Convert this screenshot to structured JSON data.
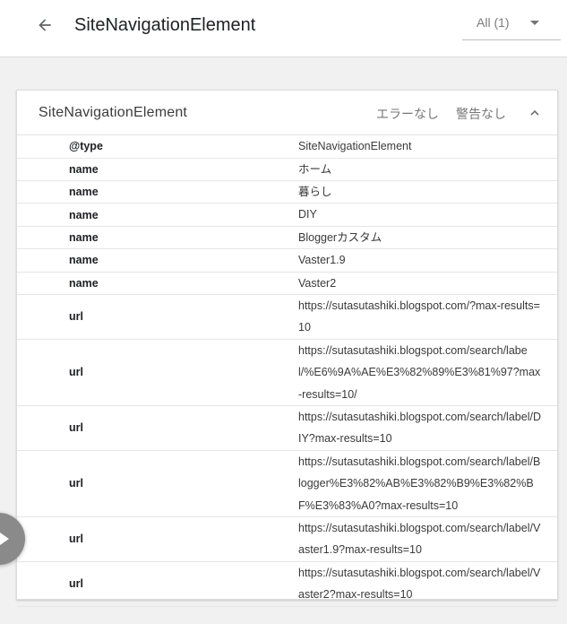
{
  "header": {
    "title": "SiteNavigationElement",
    "filter_label": "All (1)",
    "back_icon": "arrow-back-icon",
    "dropdown_icon": "caret-down-icon"
  },
  "card": {
    "title": "SiteNavigationElement",
    "errors": "エラーなし",
    "warnings": "警告なし",
    "collapse_icon": "chevron-up-icon"
  },
  "rows": [
    {
      "key": "@type",
      "value": "SiteNavigationElement"
    },
    {
      "key": "name",
      "value": "ホーム"
    },
    {
      "key": "name",
      "value": "暮らし"
    },
    {
      "key": "name",
      "value": "DIY"
    },
    {
      "key": "name",
      "value": "Bloggerカスタム"
    },
    {
      "key": "name",
      "value": "Vaster1.9"
    },
    {
      "key": "name",
      "value": "Vaster2"
    },
    {
      "key": "url",
      "value": "https://sutasutashiki.blogspot.com/?max-results=10"
    },
    {
      "key": "url",
      "value": "https://sutasutashiki.blogspot.com/search/label/%E6%9A%AE%E3%82%89%E3%81%97?max-results=10/"
    },
    {
      "key": "url",
      "value": "https://sutasutashiki.blogspot.com/search/label/DIY?max-results=10"
    },
    {
      "key": "url",
      "value": "https://sutasutashiki.blogspot.com/search/label/Blogger%E3%82%AB%E3%82%B9%E3%82%BF%E3%83%A0?max-results=10"
    },
    {
      "key": "url",
      "value": "https://sutasutashiki.blogspot.com/search/label/Vaster1.9?max-results=10"
    },
    {
      "key": "url",
      "value": "https://sutasutashiki.blogspot.com/search/label/Vaster2?max-results=10"
    }
  ],
  "fab": {
    "icon": "play-icon"
  }
}
